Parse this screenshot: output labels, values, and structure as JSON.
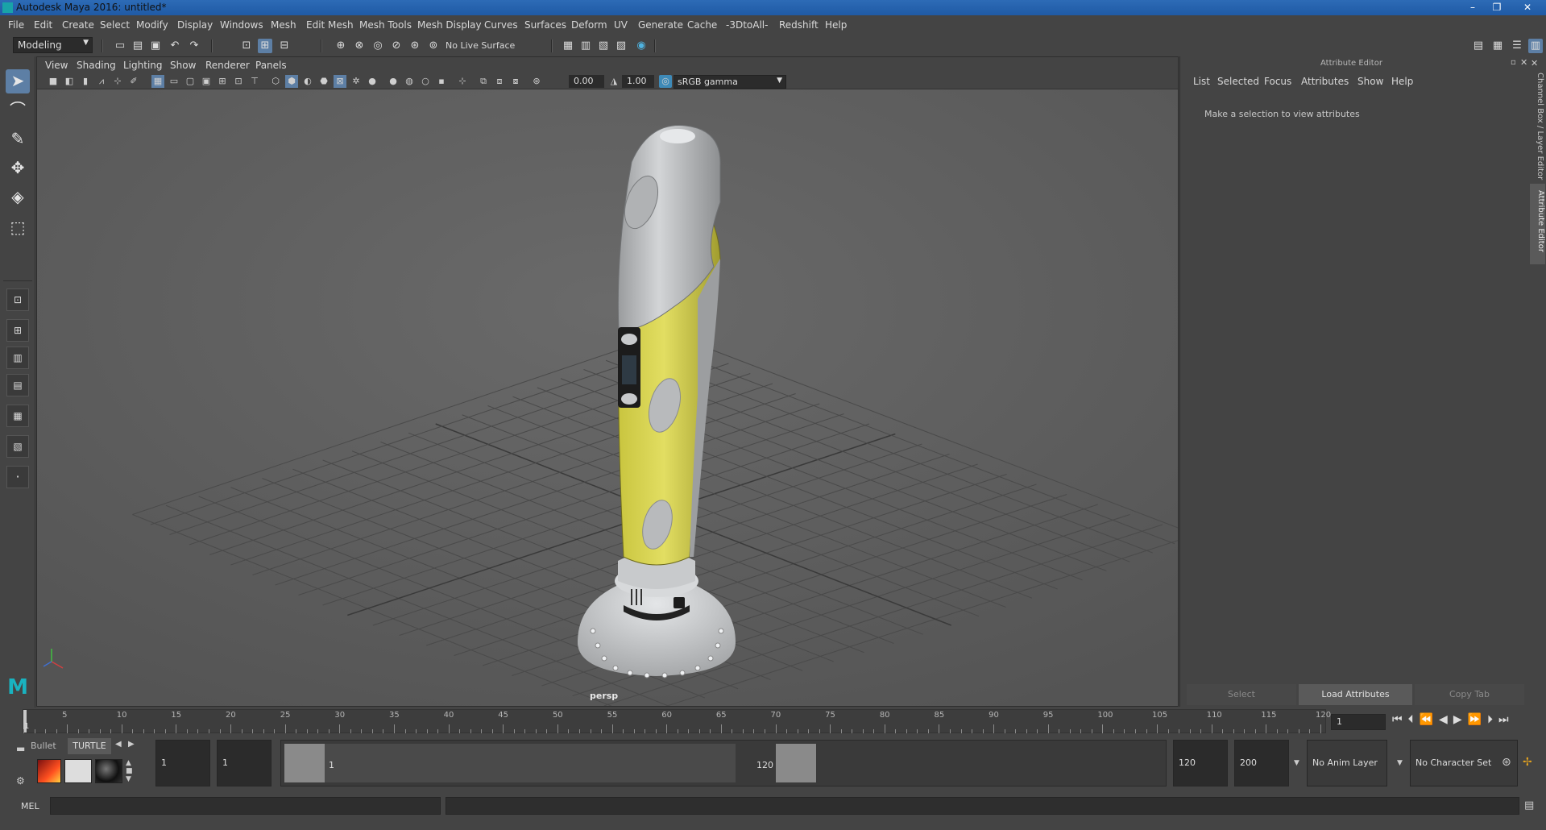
{
  "window": {
    "title": "Autodesk Maya 2016: untitled*",
    "minimize": "–",
    "restore": "❐",
    "close": "✕"
  },
  "menubar": [
    "File",
    "Edit",
    "Create",
    "Select",
    "Modify",
    "Display",
    "Windows",
    "Mesh",
    "Edit Mesh",
    "Mesh Tools",
    "Mesh Display",
    "Curves",
    "Surfaces",
    "Deform",
    "UV",
    "Generate",
    "Cache",
    "-3DtoAll-",
    "Redshift",
    "Help"
  ],
  "statusline": {
    "mode": "Modeling",
    "live_surface": "No Live Surface"
  },
  "viewport": {
    "menu": [
      "View",
      "Shading",
      "Lighting",
      "Show",
      "Renderer",
      "Panels"
    ],
    "exposure": "0.00",
    "gamma": "1.00",
    "color_space": "sRGB gamma",
    "camera_label": "persp"
  },
  "attribute_editor": {
    "title": "Attribute Editor",
    "tabs": [
      "List",
      "Selected",
      "Focus",
      "Attributes",
      "Show",
      "Help"
    ],
    "message": "Make a selection to view attributes",
    "buttons": {
      "select": "Select",
      "load": "Load Attributes",
      "copy_tab": "Copy Tab"
    },
    "side_tabs": {
      "channel_box": "Channel Box / Layer Editor",
      "attribute_editor": "Attribute Editor"
    }
  },
  "timeline": {
    "ticks": [
      "5",
      "10",
      "15",
      "20",
      "25",
      "30",
      "35",
      "40",
      "45",
      "50",
      "55",
      "60",
      "65",
      "70",
      "75",
      "80",
      "85",
      "90",
      "95",
      "100",
      "105",
      "110",
      "115",
      "120"
    ],
    "current_frame_marker": "1",
    "current_frame": "1"
  },
  "range_slider": {
    "shelf_tabs": [
      "Bullet",
      "TURTLE"
    ],
    "start_frame": "1",
    "playback_start": "1",
    "range_start_label": "1",
    "range_end_label": "120",
    "playback_end": "120",
    "end_frame": "200",
    "anim_layer": "No Anim Layer",
    "character_set": "No Character Set"
  },
  "command_line": {
    "label": "MEL"
  },
  "colors": {
    "title_bar": "#2063b0",
    "viewport_bg": "#595959",
    "model_yellow": "#d4d04a",
    "model_grey": "#b7b9bb",
    "accent": "#5d7fa5"
  }
}
